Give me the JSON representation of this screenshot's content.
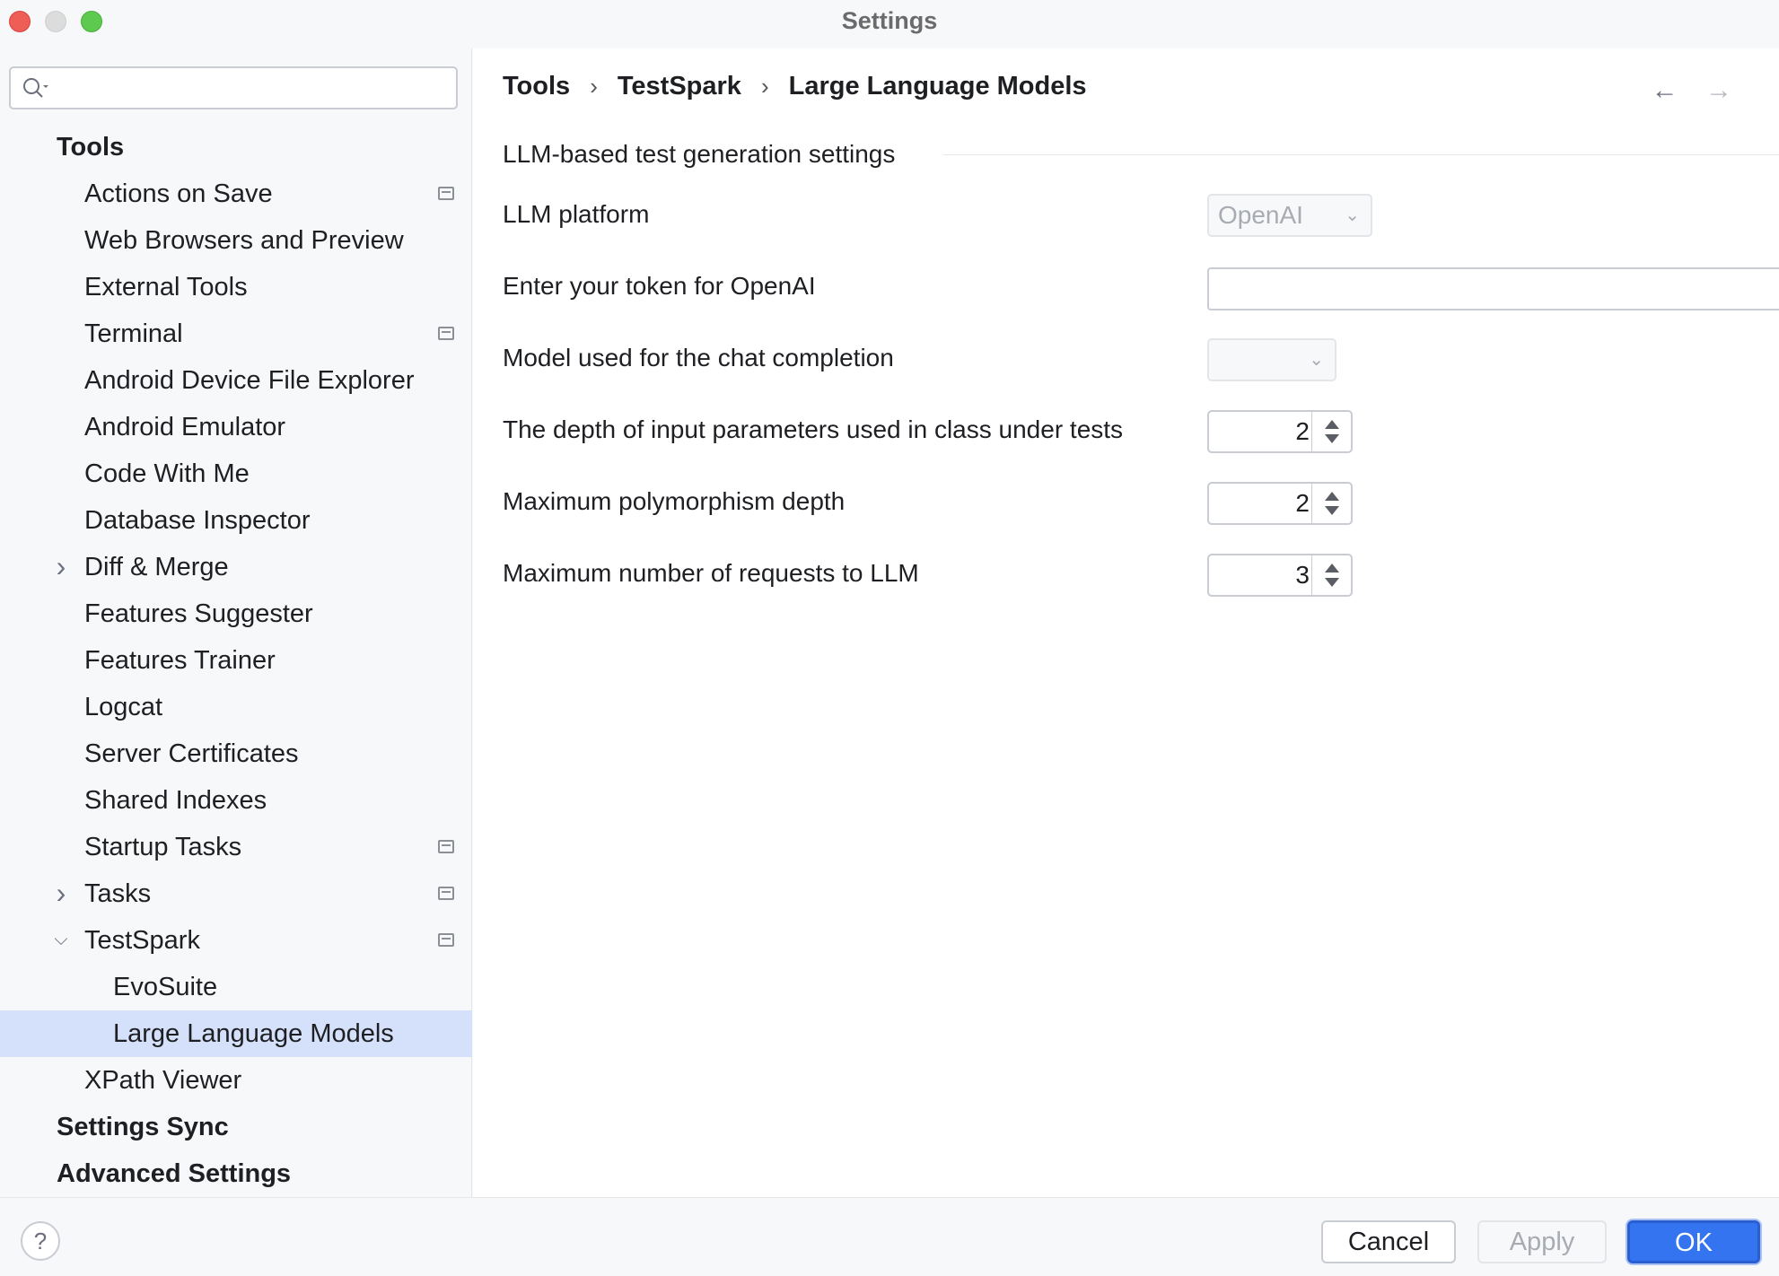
{
  "window": {
    "title": "Settings"
  },
  "search": {
    "placeholder": ""
  },
  "sidebar": {
    "items": [
      {
        "label": "Tools",
        "level": 0
      },
      {
        "label": "Actions on Save",
        "level": 1,
        "project_icon": true
      },
      {
        "label": "Web Browsers and Preview",
        "level": 1
      },
      {
        "label": "External Tools",
        "level": 1
      },
      {
        "label": "Terminal",
        "level": 1,
        "project_icon": true
      },
      {
        "label": "Android Device File Explorer",
        "level": 1
      },
      {
        "label": "Android Emulator",
        "level": 1
      },
      {
        "label": "Code With Me",
        "level": 1
      },
      {
        "label": "Database Inspector",
        "level": 1
      },
      {
        "label": "Diff & Merge",
        "level": 1,
        "expandable": "collapsed"
      },
      {
        "label": "Features Suggester",
        "level": 1
      },
      {
        "label": "Features Trainer",
        "level": 1
      },
      {
        "label": "Logcat",
        "level": 1
      },
      {
        "label": "Server Certificates",
        "level": 1
      },
      {
        "label": "Shared Indexes",
        "level": 1
      },
      {
        "label": "Startup Tasks",
        "level": 1,
        "project_icon": true
      },
      {
        "label": "Tasks",
        "level": 1,
        "expandable": "collapsed",
        "project_icon": true
      },
      {
        "label": "TestSpark",
        "level": 1,
        "expandable": "expanded",
        "project_icon": true
      },
      {
        "label": "EvoSuite",
        "level": 2
      },
      {
        "label": "Large Language Models",
        "level": 2,
        "selected": true
      },
      {
        "label": "XPath Viewer",
        "level": 1
      },
      {
        "label": "Settings Sync",
        "level": 0
      },
      {
        "label": "Advanced Settings",
        "level": 0
      }
    ]
  },
  "breadcrumb": {
    "items": [
      "Tools",
      "TestSpark",
      "Large Language Models"
    ],
    "separator": "›"
  },
  "nav": {
    "back": "←",
    "forward": "→"
  },
  "main": {
    "section_title": "LLM-based test generation settings",
    "llm_platform": {
      "label": "LLM platform",
      "value": "OpenAI"
    },
    "token": {
      "label": "Enter your token for OpenAI",
      "value": ""
    },
    "model": {
      "label": "Model used for the chat completion",
      "value": ""
    },
    "input_depth": {
      "label": "The depth of input parameters used in class under tests",
      "value": "2"
    },
    "polymorphism_depth": {
      "label": "Maximum polymorphism depth",
      "value": "2"
    },
    "max_requests": {
      "label": "Maximum number of requests to LLM",
      "value": "3"
    }
  },
  "footer": {
    "help": "?",
    "cancel": "Cancel",
    "apply": "Apply",
    "ok": "OK"
  },
  "colors": {
    "accent": "#3574f0",
    "selection": "#d5e1fa"
  }
}
